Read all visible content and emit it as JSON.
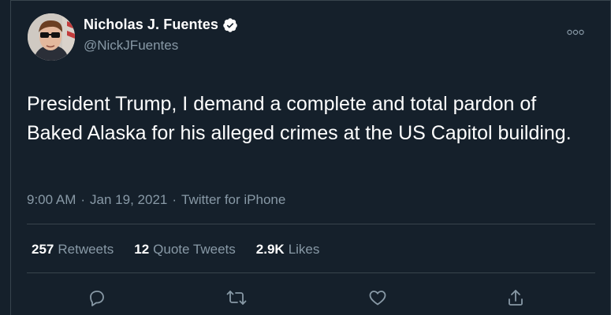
{
  "tweet": {
    "author": {
      "display_name": "Nicholas J. Fuentes",
      "handle": "@NickJFuentes",
      "verified": true
    },
    "text": "President Trump, I demand a complete and total pardon of Baked Alaska for his alleged crimes at the US Capitol building.",
    "time": "9:00 AM",
    "date": "Jan 19, 2021",
    "source": "Twitter for iPhone",
    "separator": "·",
    "stats": [
      {
        "count": "257",
        "label": "Retweets"
      },
      {
        "count": "12",
        "label": "Quote Tweets"
      },
      {
        "count": "2.9K",
        "label": "Likes"
      }
    ]
  },
  "icons": {
    "more": "more-horizontal-icon",
    "reply": "reply-icon",
    "retweet": "retweet-icon",
    "like": "heart-icon",
    "share": "share-icon",
    "verified": "verified-badge-icon"
  },
  "colors": {
    "background": "#15202b",
    "text": "#ffffff",
    "secondary": "#8899a6",
    "divider": "#38444d"
  }
}
